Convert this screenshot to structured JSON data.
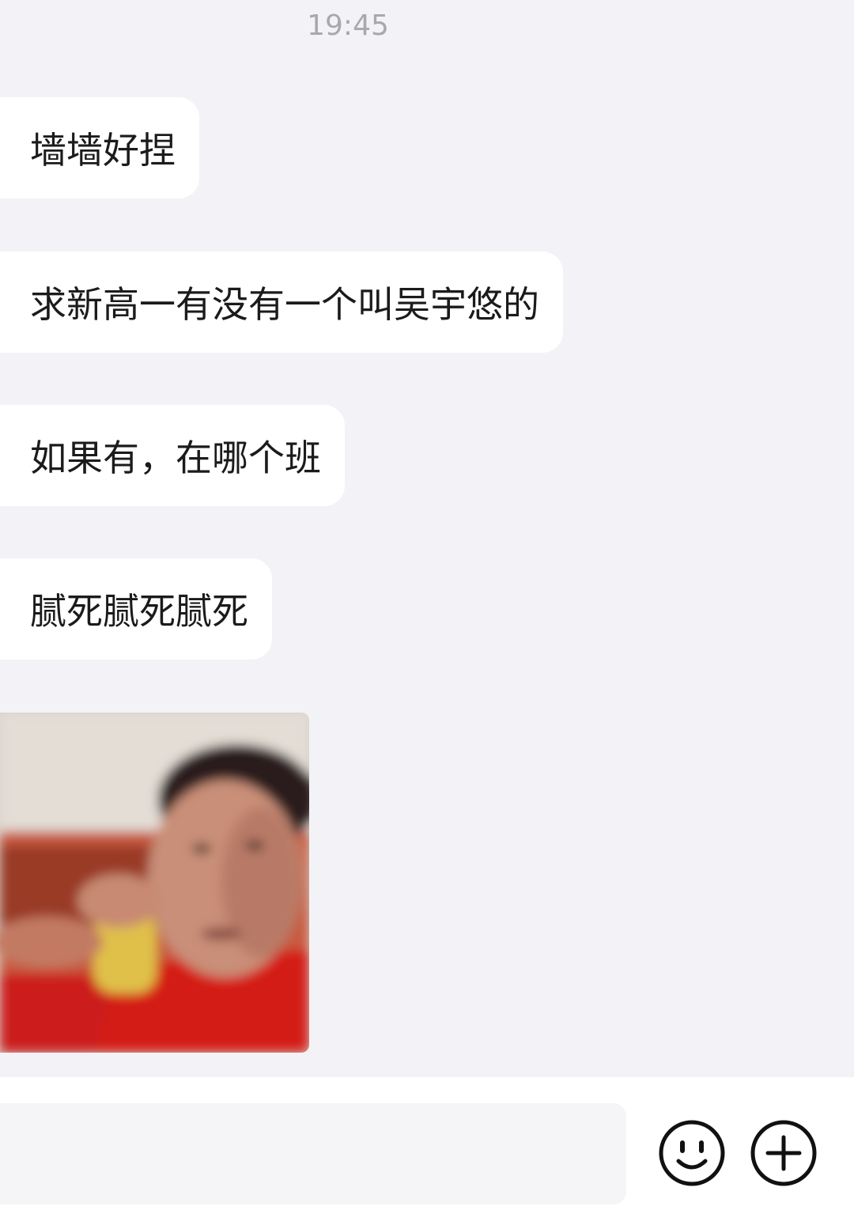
{
  "chat": {
    "timestamp": "19:45",
    "messages": [
      {
        "type": "text",
        "text": "墙墙好捏"
      },
      {
        "type": "text",
        "text": "求新高一有没有一个叫吴宇悠的"
      },
      {
        "type": "text",
        "text": "如果有，在哪个班"
      },
      {
        "type": "text",
        "text": "腻死腻死腻死"
      },
      {
        "type": "image",
        "subject": "photo-sticker"
      }
    ]
  },
  "input_bar": {
    "value": "",
    "icons": [
      "emoji-icon",
      "plus-icon"
    ]
  },
  "colors": {
    "background": "#f3f2f6",
    "bubble": "#ffffff",
    "text": "#1b1b1b",
    "timestamp": "#a9a9ad"
  }
}
